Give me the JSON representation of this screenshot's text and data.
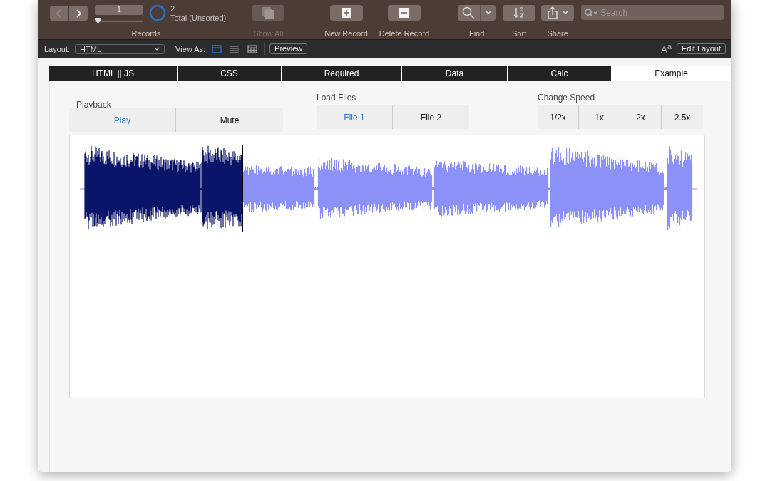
{
  "toolbar": {
    "record_number": "1",
    "record_slider": {
      "level": 0
    },
    "found_count": "2",
    "found_status": "Total (Unsorted)",
    "records_label": "Records",
    "tools": [
      {
        "kind": "showall",
        "label": "Show All",
        "disabled": true
      },
      {
        "kind": "new",
        "label": "New Record",
        "disabled": false
      },
      {
        "kind": "delete",
        "label": "Delete Record",
        "disabled": false
      },
      {
        "kind": "find",
        "label": "Find",
        "disabled": false
      },
      {
        "kind": "sort",
        "label": "Sort",
        "disabled": false
      },
      {
        "kind": "share",
        "label": "Share",
        "disabled": false
      }
    ],
    "search": {
      "placeholder": "Search"
    }
  },
  "layout_bar": {
    "layout_label": "Layout:",
    "layout_value": "HTML",
    "view_as_label": "View As:",
    "view_modes": [
      {
        "kind": "form",
        "selected": true
      },
      {
        "kind": "list",
        "selected": false
      },
      {
        "kind": "table",
        "selected": false
      }
    ],
    "preview": "Preview",
    "font_icon": "A$^{a}$",
    "edit_layout": "Edit Layout"
  },
  "tabs": [
    {
      "label": "HTML || JS",
      "selected": false
    },
    {
      "label": "CSS",
      "selected": false
    },
    {
      "label": "Required",
      "selected": false
    },
    {
      "label": "Data",
      "selected": false
    },
    {
      "label": "Calc",
      "selected": false
    },
    {
      "label": "Example",
      "selected": true
    }
  ],
  "groups": [
    {
      "title": "Playback",
      "buttons": [
        {
          "label": "Play",
          "selected": true
        },
        {
          "label": "Mute",
          "selected": false
        }
      ]
    },
    {
      "title": "Load Files",
      "buttons": [
        {
          "label": "File 1",
          "selected": true
        },
        {
          "label": "File 2",
          "selected": false
        }
      ]
    },
    {
      "title": "Change Speed",
      "buttons": [
        {
          "label": "1/2x",
          "selected": false
        },
        {
          "label": "1x",
          "selected": false
        },
        {
          "label": "2x",
          "selected": false
        },
        {
          "label": "2.5x",
          "selected": false
        }
      ]
    }
  ],
  "waveform": {
    "level": 0.26
  }
}
